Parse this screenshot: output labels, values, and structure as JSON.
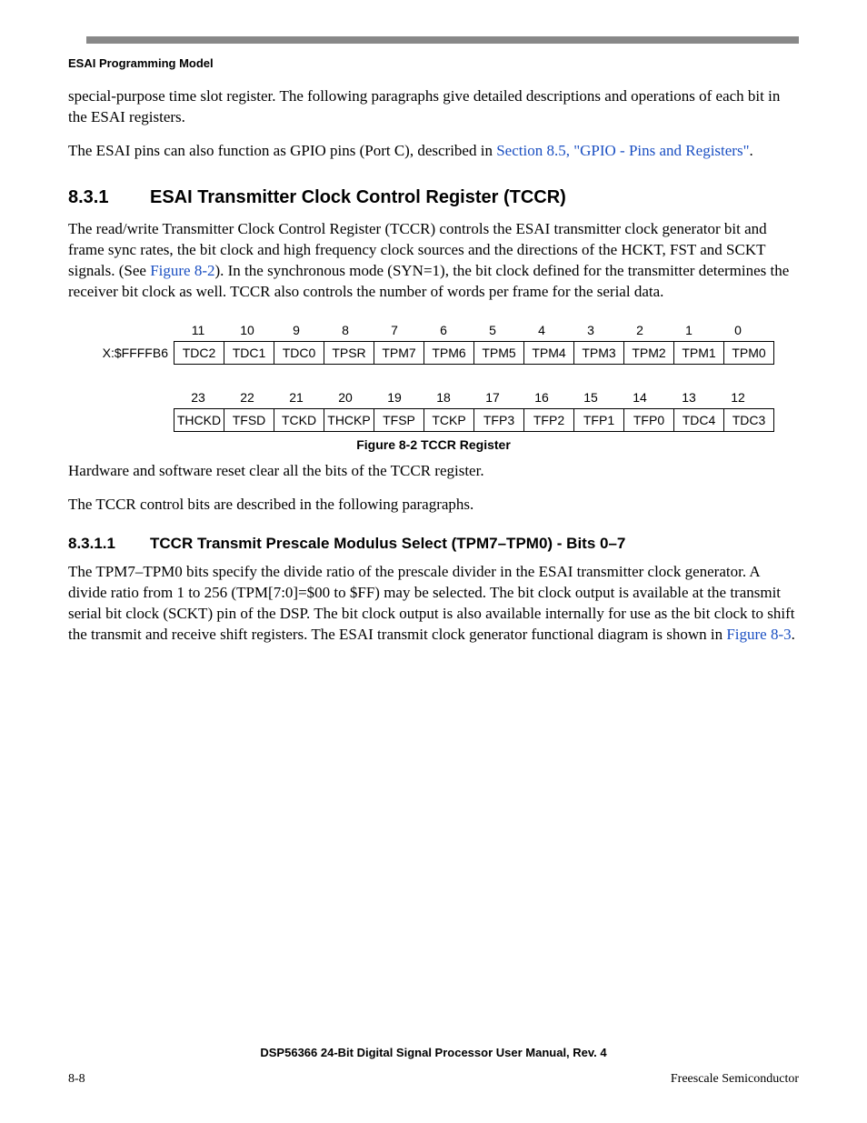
{
  "running_head": "ESAI Programming Model",
  "para1": "special-purpose time slot register. The following paragraphs give detailed descriptions and operations of each bit in the ESAI registers.",
  "para2a": "The ESAI pins can also function as GPIO pins (Port C), described in ",
  "para2_link": "Section 8.5, \"GPIO - Pins and Registers\"",
  "para2b": ".",
  "sec": {
    "num": "8.3.1",
    "title": "ESAI Transmitter Clock Control Register (TCCR)"
  },
  "para3a": "The read/write Transmitter Clock Control Register (TCCR) controls the ESAI transmitter clock generator bit and frame sync rates, the bit clock and high frequency clock sources and the directions of the HCKT, FST and SCKT signals. (See ",
  "para3_link": "Figure 8-2",
  "para3b": "). In the synchronous mode (SYN=1), the bit clock defined for the transmitter determines the receiver bit clock as well. TCCR also controls the number of words per frame for the serial data.",
  "register": {
    "addr": "X:$FFFFB6",
    "row1_bits": [
      "11",
      "10",
      "9",
      "8",
      "7",
      "6",
      "5",
      "4",
      "3",
      "2",
      "1",
      "0"
    ],
    "row1_names": [
      "TDC2",
      "TDC1",
      "TDC0",
      "TPSR",
      "TPM7",
      "TPM6",
      "TPM5",
      "TPM4",
      "TPM3",
      "TPM2",
      "TPM1",
      "TPM0"
    ],
    "row2_bits": [
      "23",
      "22",
      "21",
      "20",
      "19",
      "18",
      "17",
      "16",
      "15",
      "14",
      "13",
      "12"
    ],
    "row2_names": [
      "THCKD",
      "TFSD",
      "TCKD",
      "THCKP",
      "TFSP",
      "TCKP",
      "TFP3",
      "TFP2",
      "TFP1",
      "TFP0",
      "TDC4",
      "TDC3"
    ]
  },
  "fig_caption": "Figure 8-2  TCCR Register",
  "para4": "Hardware and software reset clear all the bits of the TCCR register.",
  "para5": "The TCCR control bits are described in the following paragraphs.",
  "subsec": {
    "num": "8.3.1.1",
    "title": "TCCR Transmit Prescale Modulus Select (TPM7–TPM0) - Bits 0–7"
  },
  "para6a": "The TPM7–TPM0 bits specify the divide ratio of the prescale divider in the ESAI transmitter clock generator. A divide ratio from 1 to 256 (TPM[7:0]=$00 to $FF) may be selected. The bit clock output is available at the transmit serial bit clock (SCKT) pin of the DSP. The bit clock output is also available internally for use as the bit clock to shift the transmit and receive shift registers. The ESAI transmit clock generator functional diagram is shown in ",
  "para6_link": "Figure 8-3",
  "para6b": ".",
  "footer": {
    "title": "DSP56366 24-Bit Digital Signal Processor User Manual, Rev. 4",
    "left": "8-8",
    "right": "Freescale Semiconductor"
  }
}
